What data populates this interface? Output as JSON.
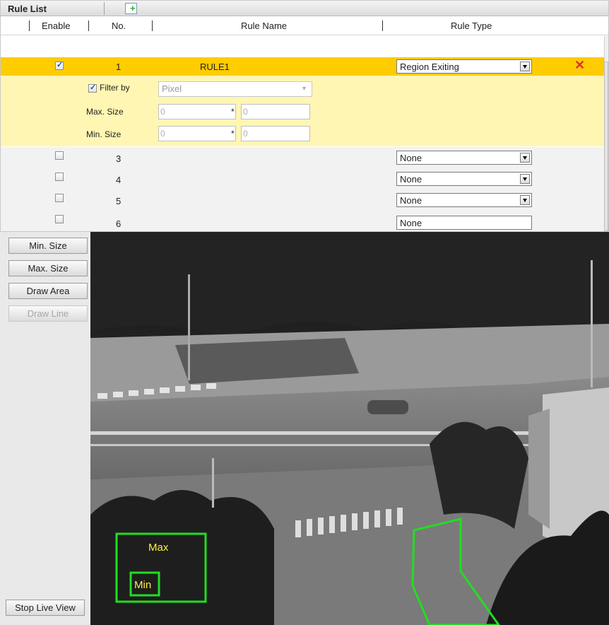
{
  "panel": {
    "title": "Rule List",
    "add_icon": "add-rule-icon"
  },
  "columns": {
    "enable": "Enable",
    "no": "No.",
    "name": "Rule Name",
    "type": "Rule Type"
  },
  "selected_rule": {
    "no": "1",
    "name": "RULE1",
    "type": "Region Exiting",
    "enabled": true,
    "delete_icon": "delete-x-icon"
  },
  "filter": {
    "label": "Filter by",
    "checked": true,
    "unit": "Pixel",
    "max_label": "Max. Size",
    "min_label": "Min. Size",
    "max_w": "0",
    "max_h": "0",
    "min_w": "0",
    "min_h": "0",
    "times": "*"
  },
  "rules": [
    {
      "no": "3",
      "type": "None"
    },
    {
      "no": "4",
      "type": "None"
    },
    {
      "no": "5",
      "type": "None"
    },
    {
      "no": "6",
      "type": "None"
    }
  ],
  "side_buttons": {
    "min": "Min. Size",
    "max": "Max. Size",
    "area": "Draw Area",
    "line": "Draw Line",
    "stop": "Stop Live View"
  },
  "overlay": {
    "max_label": "Max",
    "min_label": "Min"
  },
  "colors": {
    "selected_row": "#ffcc00",
    "expanded_bg": "#fff6b3",
    "overlay": "#22dd22",
    "overlay_text": "#ffee44",
    "delete": "#e03030"
  }
}
